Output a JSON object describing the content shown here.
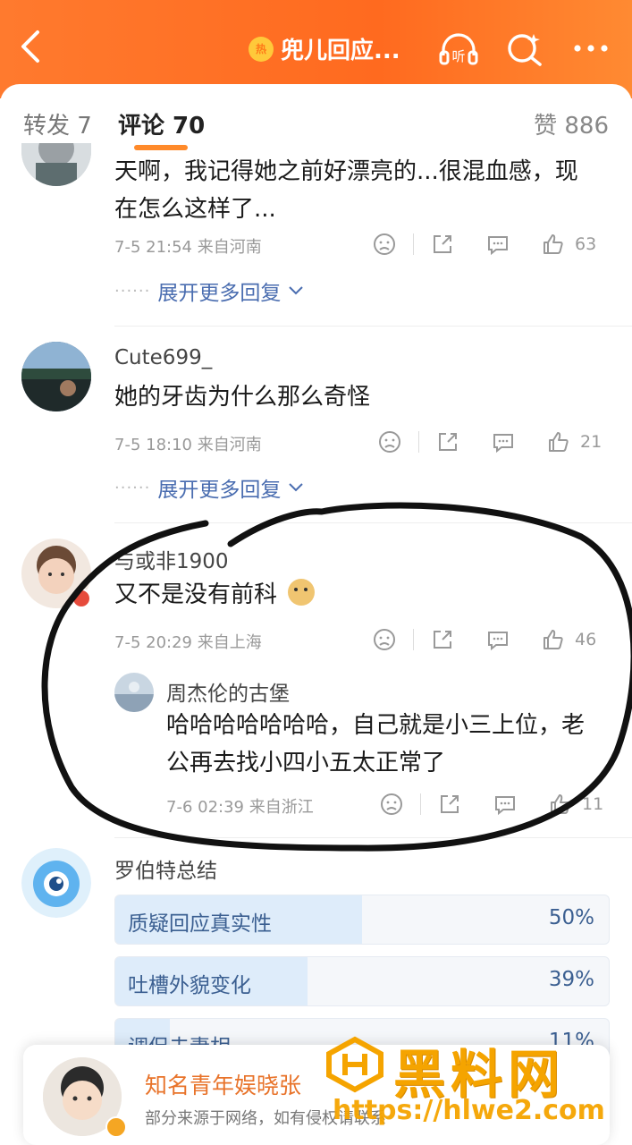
{
  "header": {
    "back_icon": "chevron-left-icon",
    "hot_badge": "热",
    "title": "兜儿回应...",
    "listen_icon": "headphones-listen-icon",
    "listen_label": "听",
    "search_icon": "search-sparkle-icon",
    "more_icon": "more-dots-icon",
    "bg_color": "#ff7a2e"
  },
  "tabs": {
    "repost": "转发 7",
    "comment": "评论 70",
    "like": "赞 886"
  },
  "comments": [
    {
      "text": "天啊，我记得她之前好漂亮的...很混血感，现在怎么这样了...",
      "line1": "天啊，我记得她之前好漂亮的...很混血感，现",
      "line2": "在怎么这样了...",
      "meta": "7-5 21:54 来自河南",
      "likes": "63",
      "expand": "展开更多回复"
    },
    {
      "user": "Cute699_",
      "text": "她的牙齿为什么那么奇怪",
      "meta": "7-5 18:10 来自河南",
      "likes": "21",
      "expand": "展开更多回复"
    },
    {
      "user": "与或非1900",
      "text": "又不是没有前科",
      "meta": "7-5 20:29 来自上海",
      "likes": "46",
      "reply": {
        "user": "周杰伦的古堡",
        "line1": "哈哈哈哈哈哈哈，自己就是小三上位，老",
        "line2": "公再去找小四小五太正常了",
        "meta": "7-6 02:39 来自浙江",
        "likes": "11"
      }
    },
    {
      "user": "罗伯特总结",
      "poll": [
        {
          "label": "质疑回应真实性",
          "pct": "50%",
          "value": 0.5
        },
        {
          "label": "吐槽外貌变化",
          "pct": "39%",
          "value": 0.39
        },
        {
          "label": "调侃夫妻相",
          "pct": "11%",
          "value": 0.11
        }
      ]
    }
  ],
  "bottom": {
    "name": "知名青年娱晓张",
    "sub": "部分来源于网络，如有侵权请联系"
  },
  "watermark": {
    "text": "黑料网",
    "url": "https://hlwe2.com"
  }
}
